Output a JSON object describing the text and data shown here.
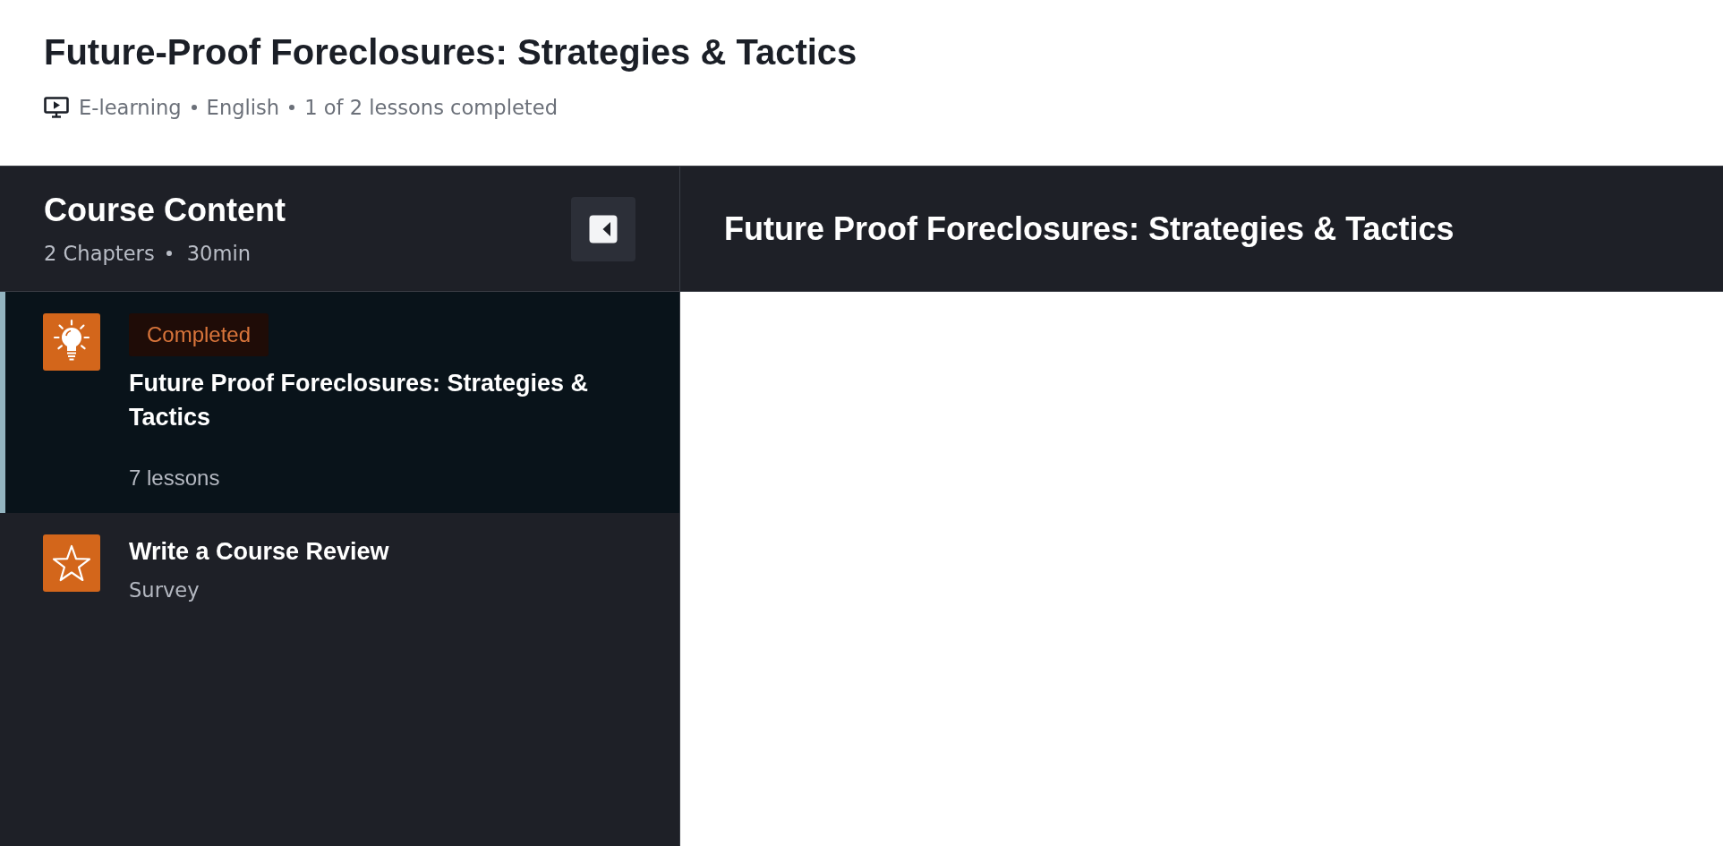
{
  "header": {
    "title": "Future-Proof Foreclosures: Strategies & Tactics",
    "meta": [
      "E-learning",
      "English",
      "1 of 2 lessons completed"
    ]
  },
  "sidebar": {
    "title": "Course Content",
    "stats": [
      "2 Chapters",
      "30min"
    ],
    "items": [
      {
        "kind": "chapter",
        "selected": true,
        "badge": "Completed",
        "title": "Future Proof Foreclosures: Strategies & Tactics",
        "subtitle": "7 lessons"
      },
      {
        "kind": "survey",
        "selected": false,
        "title": "Write a Course Review",
        "subtitle": "Survey"
      }
    ]
  },
  "content": {
    "title": "Future Proof Foreclosures: Strategies & Tactics"
  }
}
